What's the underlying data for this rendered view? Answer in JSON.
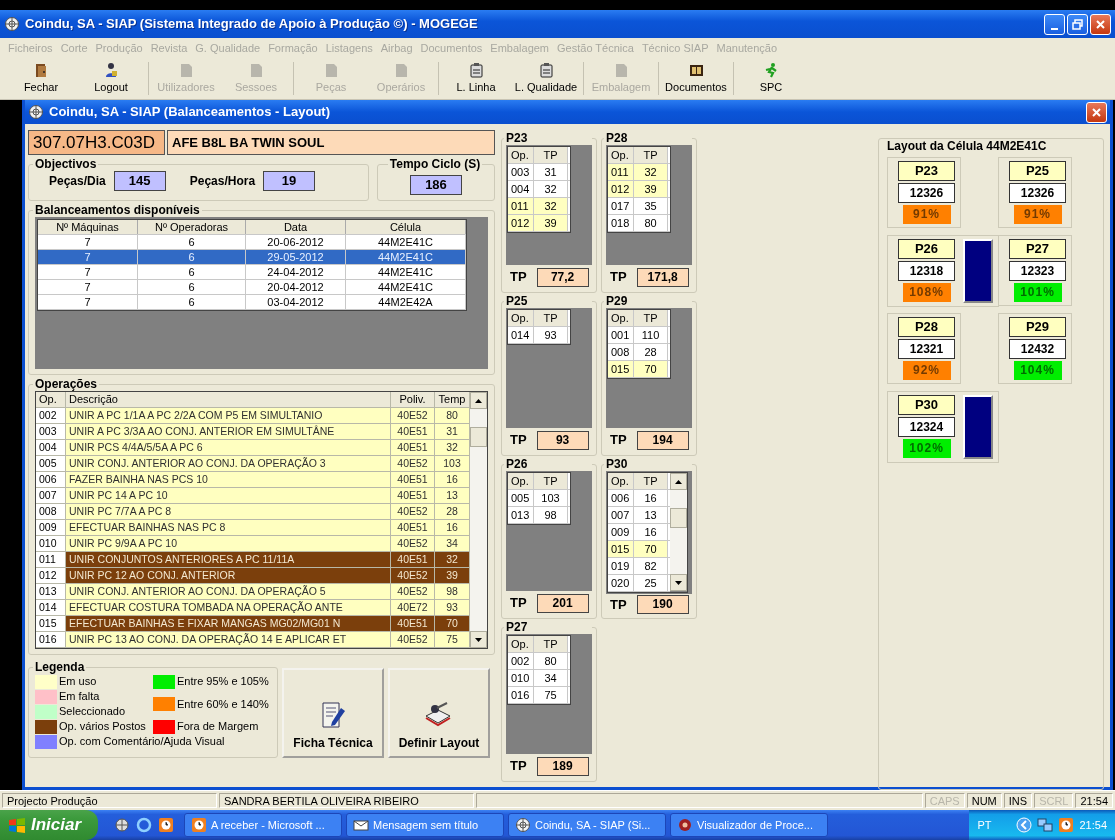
{
  "window": {
    "title": "Coindu, SA - SIAP (Sistema Integrado de Apoio à Produção ©) - MOGEGE"
  },
  "menu": [
    {
      "label": "Ficheiros",
      "disabled": true
    },
    {
      "label": "Corte",
      "disabled": true
    },
    {
      "label": "Produção",
      "disabled": true
    },
    {
      "label": "Revista",
      "disabled": true
    },
    {
      "label": "G. Qualidade",
      "disabled": true
    },
    {
      "label": "Formação",
      "disabled": true
    },
    {
      "label": "Listagens",
      "disabled": true
    },
    {
      "label": "Airbag",
      "disabled": true
    },
    {
      "label": "Documentos",
      "disabled": true
    },
    {
      "label": "Embalagem",
      "disabled": true
    },
    {
      "label": "Gestão Técnica",
      "disabled": true
    },
    {
      "label": "Técnico SIAP",
      "disabled": true
    },
    {
      "label": "Manutenção",
      "disabled": true
    }
  ],
  "toolbar": [
    {
      "label": "Fechar",
      "disabled": false
    },
    {
      "label": "Logout",
      "disabled": false
    },
    {
      "label": "Utilizadores",
      "disabled": true
    },
    {
      "label": "Sessoes",
      "disabled": true
    },
    {
      "label": "Peças",
      "disabled": true
    },
    {
      "label": "Operários",
      "disabled": true
    },
    {
      "label": "L. Linha",
      "disabled": false
    },
    {
      "label": "L. Qualidade",
      "disabled": false
    },
    {
      "label": "Embalagem",
      "disabled": true
    },
    {
      "label": "Documentos",
      "disabled": false
    },
    {
      "label": "SPC",
      "disabled": false
    }
  ],
  "dialog": {
    "title": "Coindu, SA - SIAP (Balanceamentos - Layout)",
    "product": {
      "code": "307.07H3.C03D",
      "name": "AFE B8L BA TWIN SOUL"
    },
    "objectives": {
      "title": "Objectivos",
      "pecas_dia_label": "Peças/Dia",
      "pecas_dia": "145",
      "pecas_hora_label": "Peças/Hora",
      "pecas_hora": "19"
    },
    "cycle_time": {
      "title": "Tempo Ciclo (S)",
      "value": "186"
    },
    "balances": {
      "title": "Balanceamentos disponíveis",
      "columns": [
        "Nº Máquinas",
        "Nº Operadoras",
        "Data",
        "Célula"
      ],
      "rows": [
        {
          "cells": [
            "7",
            "6",
            "20-06-2012",
            "44M2E41C"
          ],
          "selected": false
        },
        {
          "cells": [
            "7",
            "6",
            "29-05-2012",
            "44M2E41C"
          ],
          "selected": true
        },
        {
          "cells": [
            "7",
            "6",
            "24-04-2012",
            "44M2E41C"
          ],
          "selected": false
        },
        {
          "cells": [
            "7",
            "6",
            "20-04-2012",
            "44M2E41C"
          ],
          "selected": false
        },
        {
          "cells": [
            "7",
            "6",
            "03-04-2012",
            "44M2E42A"
          ],
          "selected": false
        }
      ]
    },
    "operations": {
      "title": "Operações",
      "columns": [
        "Op.",
        "Descrição",
        "Poliv.",
        "Temp"
      ],
      "rows": [
        {
          "op": "002",
          "description": "UNIR A PC 1/1A A PC 2/2A COM P5 EM SIMULTANIO",
          "poliv": "40E52",
          "time": "80",
          "color": "#ffffc0"
        },
        {
          "op": "003",
          "description": "UNIR A PC 3/3A AO CONJ. ANTERIOR EM SIMULTÂNE",
          "poliv": "40E51",
          "time": "31",
          "color": "#ffffc0"
        },
        {
          "op": "004",
          "description": "UNIR PCS 4/4A/5/5A A PC 6",
          "poliv": "40E51",
          "time": "32",
          "color": "#ffffc0"
        },
        {
          "op": "005",
          "description": "UNIR CONJ. ANTERIOR AO CONJ. DA OPERAÇÃO 3",
          "poliv": "40E52",
          "time": "103",
          "color": "#ffffc0"
        },
        {
          "op": "006",
          "description": "FAZER BAINHA NAS PCS 10",
          "poliv": "40E51",
          "time": "16",
          "color": "#ffffc0"
        },
        {
          "op": "007",
          "description": "UNIR PC 14 A PC 10",
          "poliv": "40E51",
          "time": "13",
          "color": "#ffffc0"
        },
        {
          "op": "008",
          "description": "UNIR PC 7/7A A PC 8",
          "poliv": "40E52",
          "time": "28",
          "color": "#ffffc0"
        },
        {
          "op": "009",
          "description": "EFECTUAR BAINHAS NAS PC 8",
          "poliv": "40E51",
          "time": "16",
          "color": "#ffffc0"
        },
        {
          "op": "010",
          "description": "UNIR PC 9/9A A PC 10",
          "poliv": "40E52",
          "time": "34",
          "color": "#ffffc0"
        },
        {
          "op": "011",
          "description": "UNIR CONJUNTOS ANTERIORES A PC 11/11A",
          "poliv": "40E51",
          "time": "32",
          "color": "#7b3f0c"
        },
        {
          "op": "012",
          "description": "UNIR PC 12 AO CONJ. ANTERIOR",
          "poliv": "40E52",
          "time": "39",
          "color": "#7b3f0c"
        },
        {
          "op": "013",
          "description": "UNIR CONJ. ANTERIOR AO CONJ. DA OPERAÇÃO 5",
          "poliv": "40E52",
          "time": "98",
          "color": "#ffffc0"
        },
        {
          "op": "014",
          "description": "EFECTUAR COSTURA TOMBADA NA OPERAÇÃO ANTE",
          "poliv": "40E72",
          "time": "93",
          "color": "#ffffc0"
        },
        {
          "op": "015",
          "description": "EFECTUAR BAINHAS E FIXAR MANGAS MG02/MG01 N",
          "poliv": "40E51",
          "time": "70",
          "color": "#7b3f0c"
        },
        {
          "op": "016",
          "description": "UNIR PC 13 AO CONJ. DA OPERAÇÃO 14 E APLICAR ET",
          "poliv": "40E52",
          "time": "75",
          "color": "#ffffc0"
        }
      ]
    },
    "legend": {
      "title": "Legenda",
      "items": [
        {
          "label": "Em uso",
          "color": "#ffffc8"
        },
        {
          "label": "Em falta",
          "color": "#ffc0c8"
        },
        {
          "label": "Seleccionado",
          "color": "#c0ffc8"
        },
        {
          "label": "Op. vários Postos",
          "color": "#7b3f0c"
        },
        {
          "label": "Op. com Comentário/Ajuda Visual",
          "color": "#8080ff"
        },
        {
          "label": "Entre 95% e 105%",
          "color": "#00ee00"
        },
        {
          "label": "Entre 60% e 140%",
          "color": "#ff8000"
        },
        {
          "label": "Fora de Margem",
          "color": "#ff0000"
        }
      ]
    },
    "buttons": [
      "Ficha Técnica",
      "Definir Layout"
    ],
    "posts": [
      {
        "title": "P23",
        "columns": [
          "Op.",
          "TP"
        ],
        "rows": [
          {
            "op": "003",
            "tp": "31",
            "color": "#ffffff"
          },
          {
            "op": "004",
            "tp": "32",
            "color": "#ffffff"
          },
          {
            "op": "011",
            "tp": "32",
            "color": "#ffffc0"
          },
          {
            "op": "012",
            "tp": "39",
            "color": "#ffffc0"
          }
        ],
        "scrollable": false,
        "tp_label": "TP",
        "tp": "77,2"
      },
      {
        "title": "P28",
        "columns": [
          "Op.",
          "TP"
        ],
        "rows": [
          {
            "op": "011",
            "tp": "32",
            "color": "#ffffc0"
          },
          {
            "op": "012",
            "tp": "39",
            "color": "#ffffc0"
          },
          {
            "op": "017",
            "tp": "35",
            "color": "#ffffff"
          },
          {
            "op": "018",
            "tp": "80",
            "color": "#ffffff"
          }
        ],
        "scrollable": false,
        "tp_label": "TP",
        "tp": "171,8"
      },
      {
        "title": "P25",
        "columns": [
          "Op.",
          "TP"
        ],
        "rows": [
          {
            "op": "014",
            "tp": "93",
            "color": "#ffffff"
          }
        ],
        "scrollable": false,
        "tp_label": "TP",
        "tp": "93"
      },
      {
        "title": "P29",
        "columns": [
          "Op.",
          "TP"
        ],
        "rows": [
          {
            "op": "001",
            "tp": "110",
            "color": "#ffffff"
          },
          {
            "op": "008",
            "tp": "28",
            "color": "#ffffff"
          },
          {
            "op": "015",
            "tp": "70",
            "color": "#ffffc0"
          }
        ],
        "scrollable": false,
        "tp_label": "TP",
        "tp": "194"
      },
      {
        "title": "P26",
        "columns": [
          "Op.",
          "TP"
        ],
        "rows": [
          {
            "op": "005",
            "tp": "103",
            "color": "#ffffff"
          },
          {
            "op": "013",
            "tp": "98",
            "color": "#ffffff"
          }
        ],
        "scrollable": false,
        "tp_label": "TP",
        "tp": "201"
      },
      {
        "title": "P30",
        "columns": [
          "Op.",
          "TP"
        ],
        "rows": [
          {
            "op": "006",
            "tp": "16",
            "color": "#ffffff"
          },
          {
            "op": "007",
            "tp": "13",
            "color": "#ffffff"
          },
          {
            "op": "009",
            "tp": "16",
            "color": "#ffffff"
          },
          {
            "op": "015",
            "tp": "70",
            "color": "#ffffc0"
          },
          {
            "op": "019",
            "tp": "82",
            "color": "#ffffff"
          },
          {
            "op": "020",
            "tp": "25",
            "color": "#ffffff"
          }
        ],
        "scrollable": true,
        "tp_label": "TP",
        "tp": "190"
      },
      {
        "title": "P27",
        "columns": [
          "Op.",
          "TP"
        ],
        "rows": [
          {
            "op": "002",
            "tp": "80",
            "color": "#ffffff"
          },
          {
            "op": "010",
            "tp": "34",
            "color": "#ffffff"
          },
          {
            "op": "016",
            "tp": "75",
            "color": "#ffffff"
          }
        ],
        "scrollable": false,
        "tp_label": "TP",
        "tp": "189"
      }
    ],
    "layout": {
      "title": "Layout da Célula 44M2E41C",
      "stations": [
        {
          "name": "P23",
          "number": "12326",
          "percent": "91%",
          "color": "#ff8000",
          "indicator": false
        },
        {
          "name": "P25",
          "number": "12326",
          "percent": "91%",
          "color": "#ff8000",
          "indicator": false
        },
        {
          "name": "P26",
          "number": "12318",
          "percent": "108%",
          "color": "#ff8000",
          "indicator": true
        },
        {
          "name": "P27",
          "number": "12323",
          "percent": "101%",
          "color": "#00ee00",
          "indicator": false
        },
        {
          "name": "P28",
          "number": "12321",
          "percent": "92%",
          "color": "#ff8000",
          "indicator": false
        },
        {
          "name": "P29",
          "number": "12432",
          "percent": "104%",
          "color": "#00ee00",
          "indicator": false
        },
        {
          "name": "P30",
          "number": "12324",
          "percent": "102%",
          "color": "#00ee00",
          "indicator": true
        }
      ]
    }
  },
  "status_bar": {
    "panels": [
      "Projecto Produção",
      "SANDRA BERTILA OLIVEIRA RIBEIRO"
    ],
    "indicators": [
      {
        "label": "CAPS",
        "on": false
      },
      {
        "label": "NUM",
        "on": true
      },
      {
        "label": "INS",
        "on": true
      },
      {
        "label": "SCRL",
        "on": false
      }
    ],
    "time": "21:54"
  },
  "taskbar": {
    "start": "Iniciar",
    "tasks": [
      "A receber - Microsoft ...",
      "Mensagem sem título",
      "Coindu, SA - SIAP (Si...",
      "Visualizador de Proce..."
    ],
    "language": "PT",
    "time": "21:54"
  }
}
